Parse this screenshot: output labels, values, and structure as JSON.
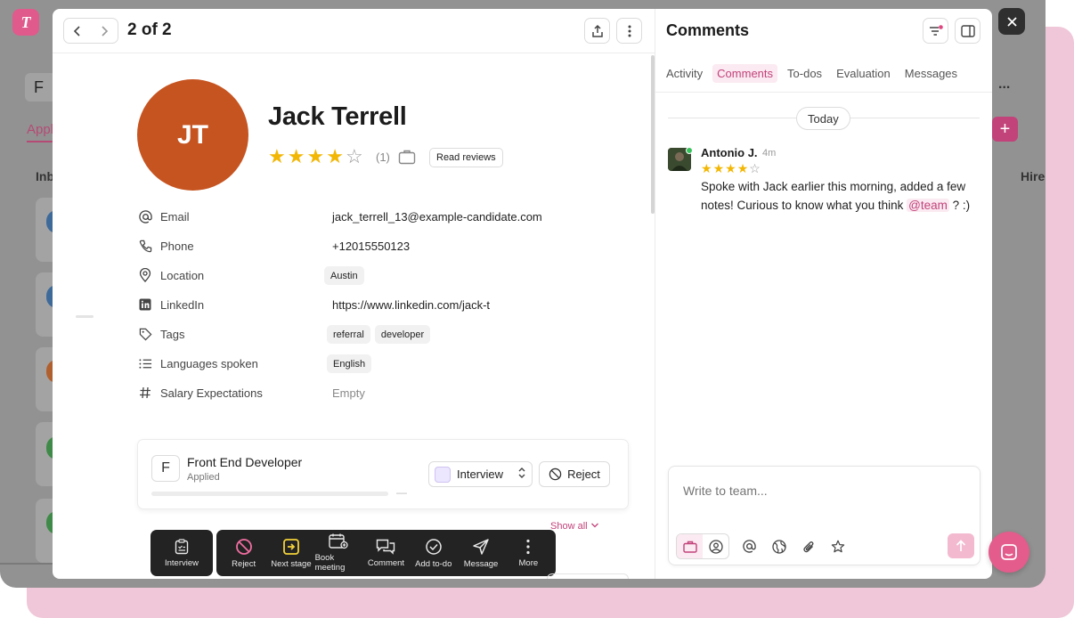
{
  "background": {
    "logo_letter": "T",
    "search_text": "F",
    "tab_label": "Appl",
    "inbox_label": "Inb",
    "hire_label": "Hire",
    "more_label": "..."
  },
  "header": {
    "counter": "2 of 2"
  },
  "candidate": {
    "initials": "JT",
    "name": "Jack Terrell",
    "rating": 4,
    "rating_max": 5,
    "review_count": "(1)",
    "read_reviews_label": "Read reviews"
  },
  "fields": {
    "email": {
      "label": "Email",
      "value": "jack_terrell_13@example-candidate.com"
    },
    "phone": {
      "label": "Phone",
      "value": "+12015550123"
    },
    "location": {
      "label": "Location",
      "value": "Austin"
    },
    "linkedin": {
      "label": "LinkedIn",
      "value": "https://www.linkedin.com/jack-t"
    },
    "tags": {
      "label": "Tags",
      "values": [
        "referral",
        "developer"
      ]
    },
    "languages": {
      "label": "Languages spoken",
      "value": "English"
    },
    "salary": {
      "label": "Salary Expectations",
      "value": "Empty"
    }
  },
  "pipeline": {
    "job_letter": "F",
    "job_title": "Front End Developer",
    "status": "Applied",
    "progress_dash": "—",
    "stage": "Interview",
    "reject_label": "Reject",
    "show_all_label": "Show all"
  },
  "actions": {
    "current": "Interview",
    "items": [
      "Reject",
      "Next stage",
      "Book meeting",
      "Comment",
      "Add to-do",
      "Message",
      "More"
    ]
  },
  "comments_panel": {
    "title": "Comments",
    "tabs": [
      "Activity",
      "Comments",
      "To-dos",
      "Evaluation",
      "Messages"
    ],
    "active_tab": "Comments",
    "date_separator": "Today",
    "comment": {
      "author": "Antonio J.",
      "time": "4m",
      "rating": 4,
      "text_before": "Spoke with Jack earlier this morning, added a few notes! Curious to know what you think ",
      "mention": "@team",
      "text_after": " ? :)"
    },
    "composer_placeholder": "Write to team..."
  },
  "colors": {
    "accent": "#c2427a",
    "avatar": "#c65420",
    "star": "#f2b705",
    "chat_button": "#e35c8b"
  }
}
